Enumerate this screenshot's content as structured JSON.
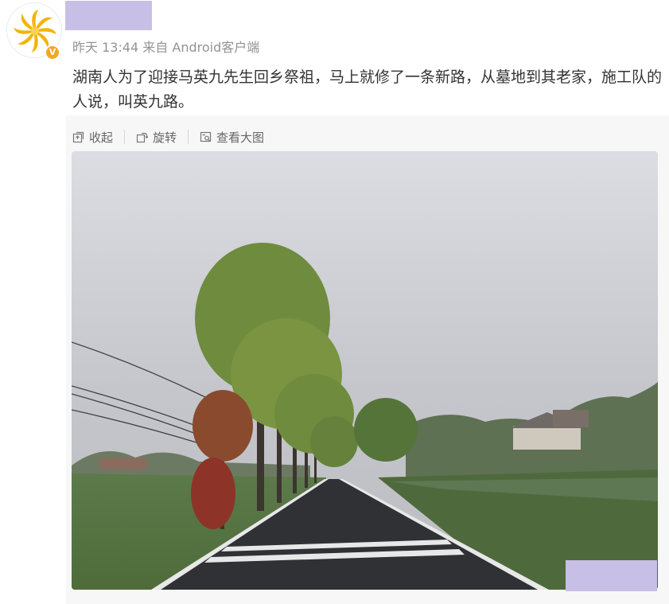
{
  "post": {
    "meta": "昨天 13:44 来自 Android客户端",
    "text": "湖南人为了迎接马英九先生回乡祭祖，马上就修了一条新路，从墓地到其老家，施工队的人说，叫英九路。"
  },
  "verified_badge": "V",
  "toolbar": {
    "collapse_label": "收起",
    "rotate_label": "旋转",
    "view_large_label": "查看大图"
  },
  "icons": [
    "avatar-logo",
    "verified-icon",
    "collapse-icon",
    "rotate-icon",
    "view-large-icon"
  ],
  "colors": {
    "text": "#333333",
    "meta": "#939393",
    "toolbar": "#666666",
    "panel": "#f7f7f7",
    "redaction": "#c8bfe6",
    "verified": "#f5a623"
  }
}
